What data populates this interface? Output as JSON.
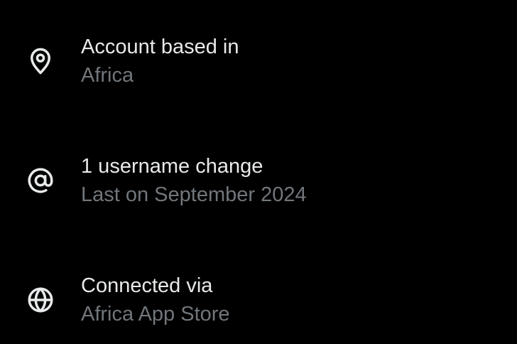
{
  "background": "#000000",
  "colors": {
    "primary_text": "#e7e9ea",
    "secondary_text": "#71767b",
    "icon": "#e7e9ea"
  },
  "items": [
    {
      "icon": "location-pin-icon",
      "title": "Account based in",
      "subtitle": "Africa"
    },
    {
      "icon": "at-sign-icon",
      "title": "1 username change",
      "subtitle": "Last on September 2024"
    },
    {
      "icon": "globe-icon",
      "title": "Connected via",
      "subtitle": "Africa App Store"
    }
  ]
}
